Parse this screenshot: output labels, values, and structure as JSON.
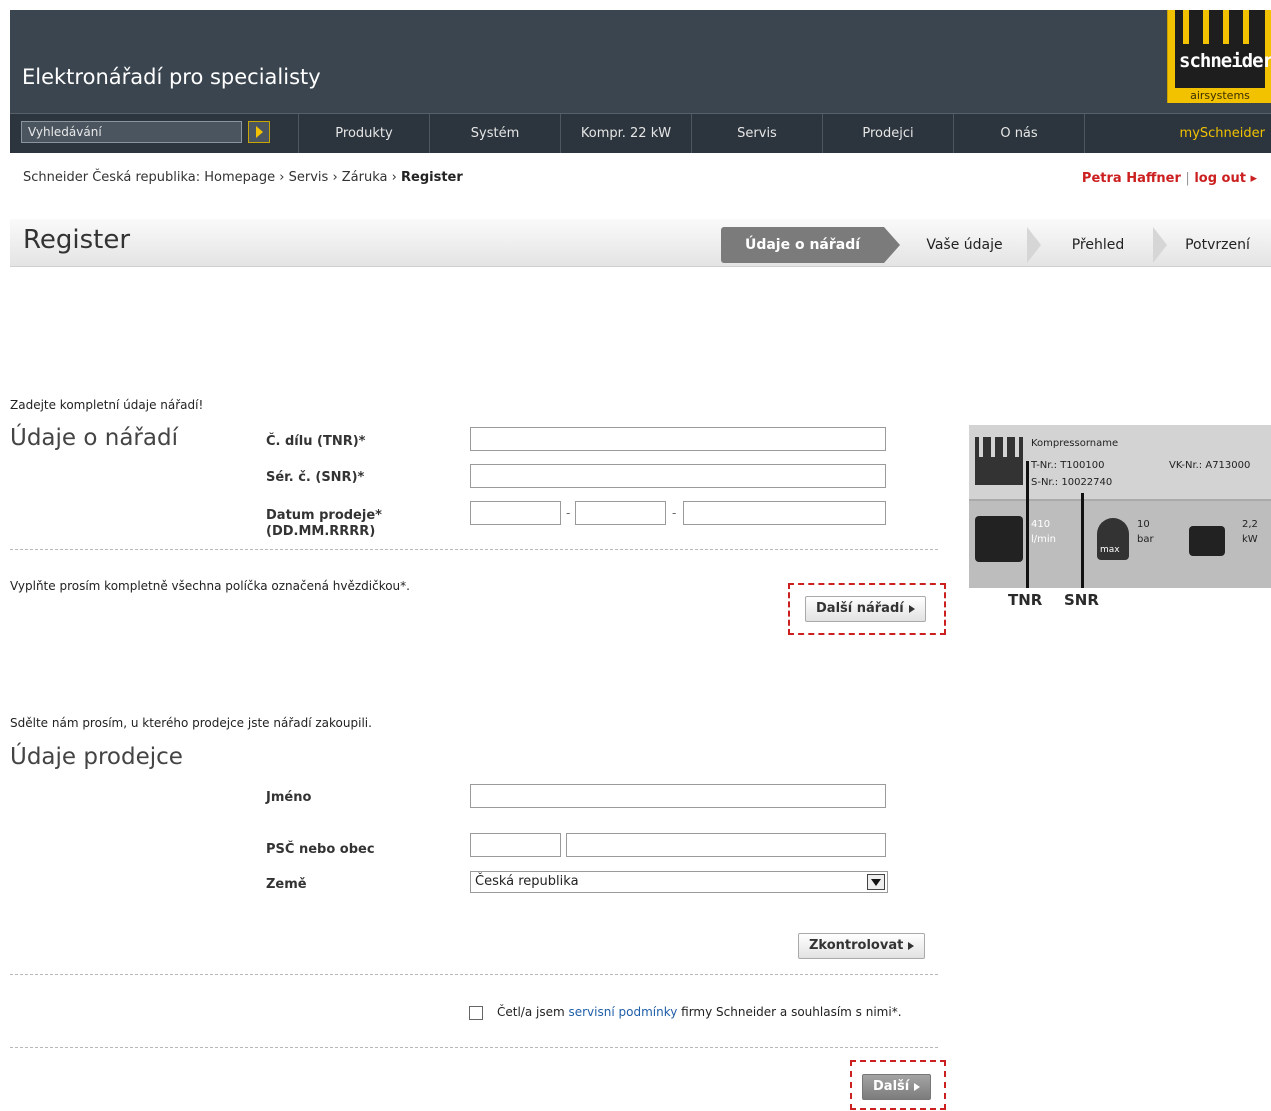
{
  "header": {
    "title": "Elektronářadí pro specialisty",
    "logo_word": "schneider",
    "logo_sub": "airsystems",
    "search_placeholder": "Vyhledávání",
    "nav": [
      "Produkty",
      "Systém",
      "Kompr. 22 kW",
      "Servis",
      "Prodejci",
      "O nás"
    ],
    "my_link": "mySchneider"
  },
  "breadcrumb": {
    "prefix": "Schneider Česká republika: ",
    "items": [
      "Homepage",
      "Servis",
      "Záruka"
    ],
    "current": "Register",
    "separator": "›"
  },
  "user": {
    "name": "Petra Haffner",
    "logout": "log out"
  },
  "register": {
    "title": "Register",
    "steps": [
      "Údaje o nářadí",
      "Vaše údaje",
      "Přehled",
      "Potvrzení"
    ]
  },
  "tool_section": {
    "hint": "Zadejte kompletní údaje nářadí!",
    "title": "Údaje o nářadí",
    "tnr_label": "Č. dílu (TNR)*",
    "snr_label": "Sér. č. (SNR)*",
    "date_label_1": "Datum prodeje*",
    "date_label_2": "(DD.MM.RRRR)",
    "date_sep": "-",
    "required_note": "Vyplňte prosím kompletně všechna políčka označená hvězdičkou*.",
    "next_tool_button": "Další nářadí"
  },
  "plate": {
    "name": "Kompressorname",
    "tnr": "T-Nr.: T100100",
    "snr": "S-Nr.: 10022740",
    "vk": "VK-Nr.: A713000",
    "flow": "410",
    "flow_unit": "l/min",
    "pressure": "10",
    "pressure_unit": "bar",
    "max_label": "max",
    "power": "2,2",
    "power_unit": "kW",
    "tag_tnr": "TNR",
    "tag_snr": "SNR"
  },
  "dealer_section": {
    "hint": "Sdělte nám prosím, u kterého prodejce jste nářadí zakoupili.",
    "title": "Údaje prodejce",
    "name_label": "Jméno",
    "zip_label": "PSČ nebo obec",
    "country_label": "Země",
    "country_value": "Česká republika",
    "check_button": "Zkontrolovat"
  },
  "agreement": {
    "text_before": "Četl/a jsem ",
    "link": "servisní podmínky",
    "text_after": " firmy Schneider a souhlasím s nimi*."
  },
  "next_button": "Další"
}
